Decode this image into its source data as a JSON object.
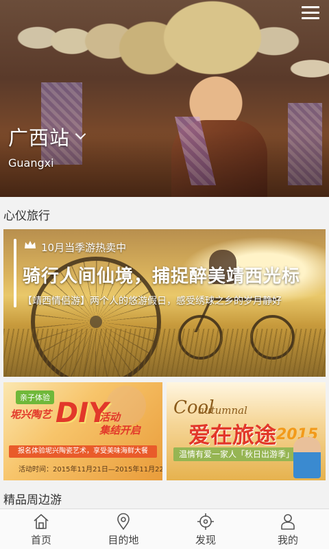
{
  "hero": {
    "city_name": "广西站",
    "city_en": "Guangxi"
  },
  "sections": {
    "featured_title": "心仪旅行",
    "nearby_title": "精品周边游"
  },
  "banner": {
    "tag": "10月当季游热卖中",
    "title": "骑行人间仙境，捕捉醉美靖西光标",
    "desc": "【靖西情侣游】两个人的悠游假日，感受绣球之乡的岁月静好"
  },
  "promo_left": {
    "badge": "亲子体验",
    "head1": "坭兴陶艺",
    "diy": "DIY",
    "head2_line1": "活动",
    "head2_line2": "集结开启",
    "bar": "报名体验坭兴陶瓷艺术，享受美味海鲜大餐",
    "date": "活动时间：2015年11月21日—2015年11月22日"
  },
  "promo_right": {
    "en_big": "Cool",
    "en_small": "autumnal",
    "cn": "爱在旅途",
    "year": "2015",
    "sub": "温情有爱一家人「秋日出游季」"
  },
  "tabbar": {
    "tabs": [
      {
        "label": "首页",
        "icon": "home-icon"
      },
      {
        "label": "目的地",
        "icon": "location-pin-icon"
      },
      {
        "label": "发现",
        "icon": "crosshair-icon"
      },
      {
        "label": "我的",
        "icon": "person-icon"
      }
    ]
  },
  "colors": {
    "accent_red": "#e2382a",
    "tab_icon": "#555555"
  }
}
